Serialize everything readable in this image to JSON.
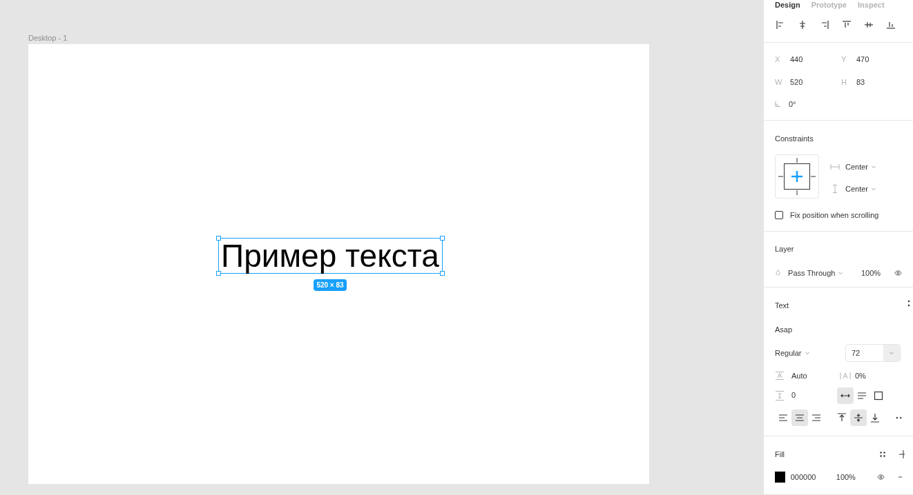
{
  "canvas": {
    "frame_label": "Desktop - 1",
    "text": "Пример текста",
    "size_badge": "520 × 83"
  },
  "tabs": [
    {
      "label": "Design",
      "selected": true
    },
    {
      "label": "Prototype",
      "selected": false
    },
    {
      "label": "Inspect",
      "selected": false
    }
  ],
  "geometry": [
    {
      "label": "X",
      "value": "440"
    },
    {
      "label": "Y",
      "value": "470"
    },
    {
      "label": "W",
      "value": "520"
    },
    {
      "label": "H",
      "value": "83"
    }
  ],
  "rotation": "0°",
  "constraints": {
    "title": "Constraints",
    "horizontal": "Center",
    "vertical": "Center",
    "fix_position": {
      "label": "Fix position when scrolling",
      "checked": false
    }
  },
  "layer": {
    "title": "Layer",
    "blend": "Pass Through",
    "opacity": "100%"
  },
  "text": {
    "title": "Text",
    "font": "Asap",
    "style": "Regular",
    "size": "72",
    "line_height": "Auto",
    "letter_spacing": "0%",
    "paragraph_spacing": "0",
    "resize": [
      {
        "kind": "auto-width",
        "selected": true
      },
      {
        "kind": "auto-height",
        "selected": false
      },
      {
        "kind": "fixed",
        "selected": false
      }
    ],
    "align_h": [
      {
        "kind": "left",
        "selected": false
      },
      {
        "kind": "center",
        "selected": true
      },
      {
        "kind": "right",
        "selected": false
      }
    ],
    "align_v": [
      {
        "kind": "top",
        "selected": false
      },
      {
        "kind": "middle",
        "selected": true
      },
      {
        "kind": "bottom",
        "selected": false
      }
    ]
  },
  "fill": {
    "title": "Fill",
    "hex": "000000",
    "color": "#000000",
    "opacity": "100%"
  }
}
